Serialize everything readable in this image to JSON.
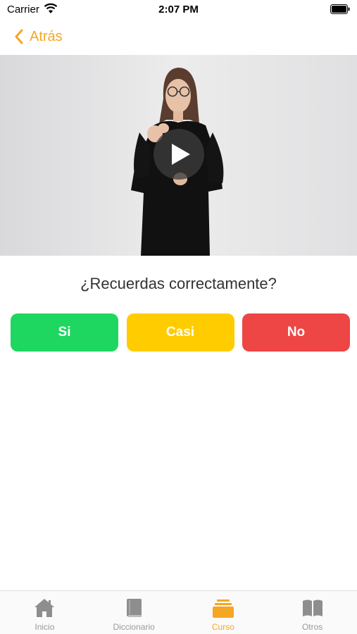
{
  "status_bar": {
    "carrier": "Carrier",
    "time": "2:07 PM"
  },
  "nav": {
    "back_label": "Atrás"
  },
  "video": {
    "play_icon": "play-icon"
  },
  "question": "¿Recuerdas correctamente?",
  "answers": [
    {
      "label": "Si",
      "color": "#1ED760"
    },
    {
      "label": "Casi",
      "color": "#FFCC00"
    },
    {
      "label": "No",
      "color": "#EE4545"
    }
  ],
  "tabbar": {
    "items": [
      {
        "label": "Inicio",
        "icon": "home-icon",
        "active": false
      },
      {
        "label": "Diccionario",
        "icon": "book-icon",
        "active": false
      },
      {
        "label": "Curso",
        "icon": "stack-icon",
        "active": true
      },
      {
        "label": "Otros",
        "icon": "open-book-icon",
        "active": false
      }
    ]
  },
  "colors": {
    "accent": "#F5A623",
    "inactive": "#999999"
  }
}
